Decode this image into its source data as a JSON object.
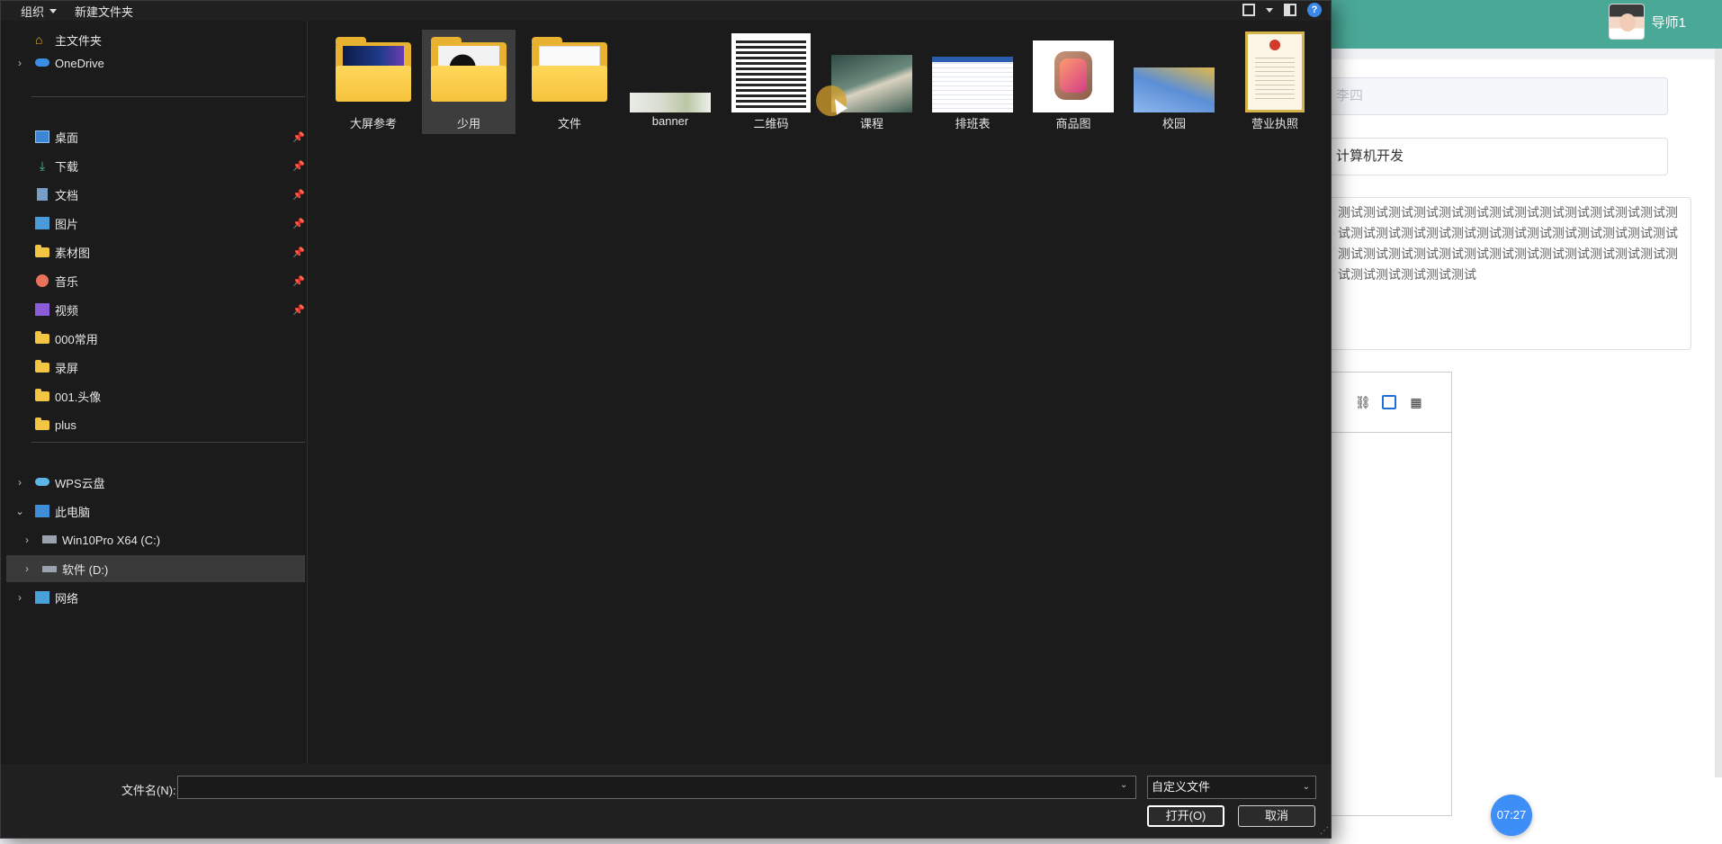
{
  "background_app": {
    "user_name": "导师1",
    "fields": {
      "name_value": "李四",
      "major_value": "计算机开发"
    },
    "textarea_value": "测试测试测试测试测试测试测试测试测试测试测试测试测试测试测试测试测试测试测试测试测试测试测试测试测试测试测试测试测试测试测试测试测试测试测试测试测试测试测试测试测试测试测试测试测试测试",
    "timer": "07:27",
    "colors": {
      "topbar": "#4aa897",
      "timer": "#3e8ef7"
    }
  },
  "dialog": {
    "toolbar": {
      "organize_label": "组织",
      "new_folder_label": "新建文件夹"
    },
    "nav": {
      "home": "主文件夹",
      "onedrive": "OneDrive",
      "quick_access": [
        {
          "label": "桌面",
          "icon": "desktop-icon"
        },
        {
          "label": "下载",
          "icon": "download-icon"
        },
        {
          "label": "文档",
          "icon": "document-icon"
        },
        {
          "label": "图片",
          "icon": "pictures-icon"
        },
        {
          "label": "素材图",
          "icon": "folder-icon"
        },
        {
          "label": "音乐",
          "icon": "music-icon"
        },
        {
          "label": "视频",
          "icon": "video-icon"
        },
        {
          "label": "000常用",
          "icon": "folder-icon"
        },
        {
          "label": "录屏",
          "icon": "folder-icon"
        },
        {
          "label": "001.头像",
          "icon": "folder-icon"
        },
        {
          "label": "plus",
          "icon": "folder-icon"
        }
      ],
      "wps": "WPS云盘",
      "this_pc": "此电脑",
      "drive_c": "Win10Pro X64 (C:)",
      "drive_d": "软件 (D:)",
      "network": "网络"
    },
    "files": [
      {
        "name": "大屏参考",
        "kind": "folder"
      },
      {
        "name": "少用",
        "kind": "folder"
      },
      {
        "name": "文件",
        "kind": "folder"
      },
      {
        "name": "banner",
        "kind": "image"
      },
      {
        "name": "二维码",
        "kind": "image"
      },
      {
        "name": "课程",
        "kind": "image"
      },
      {
        "name": "排班表",
        "kind": "image"
      },
      {
        "name": "商品图",
        "kind": "image"
      },
      {
        "name": "校园",
        "kind": "image"
      },
      {
        "name": "营业执照",
        "kind": "image"
      }
    ],
    "filename_label": "文件名(N):",
    "filename_value": "",
    "filetype_value": "自定义文件",
    "open_button": "打开(O)",
    "cancel_button": "取消"
  }
}
